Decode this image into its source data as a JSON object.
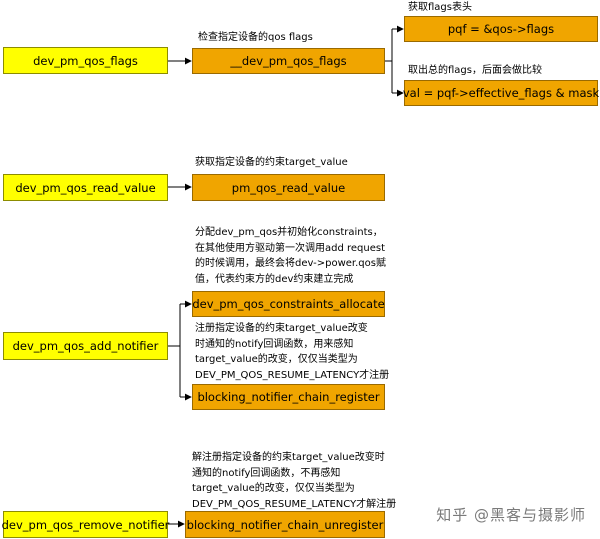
{
  "boxes": {
    "flags": "dev_pm_qos_flags",
    "flags_impl": "__dev_pm_qos_flags",
    "pqf": "pqf = &qos->flags",
    "val": "val = pqf->effective_flags & mask",
    "read_value": "dev_pm_qos_read_value",
    "read_value_impl": "pm_qos_read_value",
    "add_notifier": "dev_pm_qos_add_notifier",
    "constraints_allocate": "dev_pm_qos_constraints_allocate",
    "chain_register": "blocking_notifier_chain_register",
    "remove_notifier": "dev_pm_qos_remove_notifier",
    "chain_unregister": "blocking_notifier_chain_unregister"
  },
  "notes": {
    "flags": "检查指定设备的qos  flags",
    "pqf": "获取flags表头",
    "val": "取出总的flags，后面会做比较",
    "read_value": "获取指定设备的约束target_value",
    "allocate": [
      "分配dev_pm_qos并初始化constraints，",
      "在其他使用方驱动第一次调用add request",
      "的时候调用，最终会将dev->power.qos赋",
      "值，代表约束方的dev约束建立完成"
    ],
    "register": [
      "注册指定设备的约束target_value改变",
      "时通知的notify回调函数，用来感知",
      "target_value的改变，仅仅当类型为",
      "DEV_PM_QOS_RESUME_LATENCY才注册"
    ],
    "unregister": [
      "解注册指定设备的约束target_value改变时",
      "通知的notify回调函数，不再感知",
      "target_value的改变，仅仅当类型为",
      "DEV_PM_QOS_RESUME_LATENCY才解注册"
    ]
  },
  "watermark": "知乎 @黑客与摄影师",
  "colors": {
    "caller_box": "#ffff00",
    "callee_box": "#f0a500",
    "line": "#000000"
  }
}
